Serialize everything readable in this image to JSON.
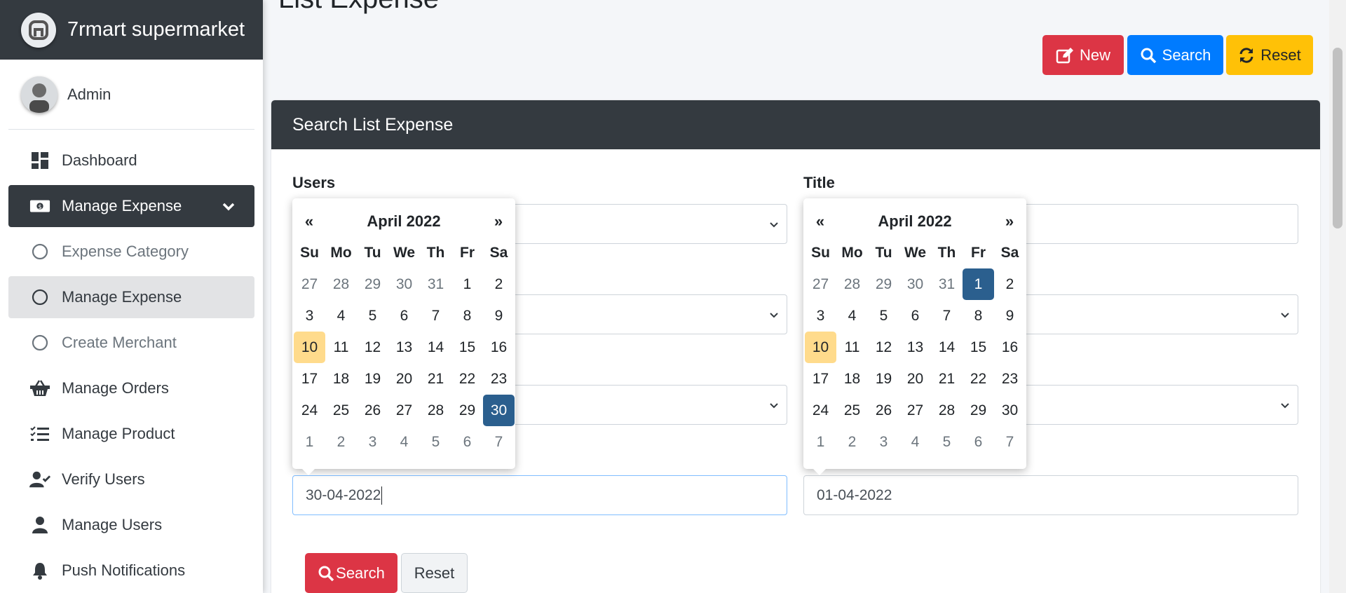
{
  "brand": {
    "name": "7rmart supermarket"
  },
  "user": {
    "name": "Admin"
  },
  "sidebar": {
    "items": [
      {
        "label": "Dashboard",
        "icon": "dashboard-icon"
      },
      {
        "label": "Manage Expense",
        "icon": "money-bill-icon"
      },
      {
        "label": "Expense Category",
        "icon": "circle-icon"
      },
      {
        "label": "Manage Expense",
        "icon": "circle-icon"
      },
      {
        "label": "Create Merchant",
        "icon": "circle-icon"
      },
      {
        "label": "Manage Orders",
        "icon": "basket-icon"
      },
      {
        "label": "Manage Product",
        "icon": "list-check-icon"
      },
      {
        "label": "Verify Users",
        "icon": "user-check-icon"
      },
      {
        "label": "Manage Users",
        "icon": "user-icon"
      },
      {
        "label": "Push Notifications",
        "icon": "bell-icon"
      }
    ]
  },
  "page": {
    "title": "List Expense"
  },
  "toolbar": {
    "new_label": "New",
    "search_label": "Search",
    "reset_label": "Reset"
  },
  "card": {
    "title": "Search List Expense"
  },
  "form": {
    "users_label": "Users",
    "title_label": "Title",
    "date_from_value": "30-04-2022",
    "date_to_value": "01-04-2022",
    "search_label": "Search",
    "reset_label": "Reset"
  },
  "datepicker_left": {
    "month": "April 2022",
    "prev": "«",
    "next": "»",
    "weekdays": [
      "Su",
      "Mo",
      "Tu",
      "We",
      "Th",
      "Fr",
      "Sa"
    ],
    "days": [
      "27",
      "28",
      "29",
      "30",
      "31",
      "1",
      "2",
      "3",
      "4",
      "5",
      "6",
      "7",
      "8",
      "9",
      "10",
      "11",
      "12",
      "13",
      "14",
      "15",
      "16",
      "17",
      "18",
      "19",
      "20",
      "21",
      "22",
      "23",
      "24",
      "25",
      "26",
      "27",
      "28",
      "29",
      "30",
      "1",
      "2",
      "3",
      "4",
      "5",
      "6",
      "7"
    ],
    "today": "10",
    "selected": "30"
  },
  "datepicker_right": {
    "month": "April 2022",
    "prev": "«",
    "next": "»",
    "weekdays": [
      "Su",
      "Mo",
      "Tu",
      "We",
      "Th",
      "Fr",
      "Sa"
    ],
    "days": [
      "27",
      "28",
      "29",
      "30",
      "31",
      "1",
      "2",
      "3",
      "4",
      "5",
      "6",
      "7",
      "8",
      "9",
      "10",
      "11",
      "12",
      "13",
      "14",
      "15",
      "16",
      "17",
      "18",
      "19",
      "20",
      "21",
      "22",
      "23",
      "24",
      "25",
      "26",
      "27",
      "28",
      "29",
      "30",
      "1",
      "2",
      "3",
      "4",
      "5",
      "6",
      "7"
    ],
    "today": "10",
    "selected": "1"
  },
  "colors": {
    "sidebar_dark": "#343a40",
    "danger": "#dc3545",
    "primary": "#007bff",
    "warning": "#ffc107",
    "selected_day": "#2b5f8e",
    "today": "#ffdb8c"
  }
}
